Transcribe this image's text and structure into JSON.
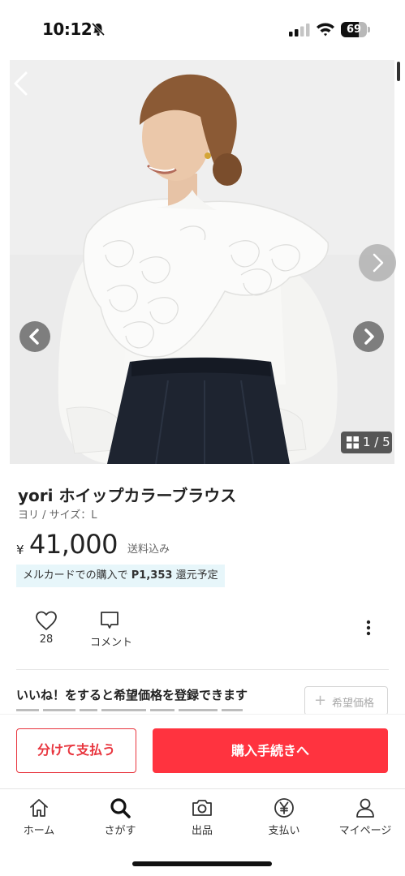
{
  "status": {
    "time": "10:12",
    "battery": "69",
    "battery_level": 0.69
  },
  "gallery": {
    "counter": "1 / 5"
  },
  "item": {
    "title": "yori ホイップカラーブラウス",
    "subtitle": "ヨリ / サイズ：L",
    "currency": "¥",
    "price": "41,000",
    "shipping": "送料込み",
    "point_prefix": "メルカードでの購入で",
    "point_value": "P1,353",
    "point_suffix": "還元予定"
  },
  "actions": {
    "like_count": "28",
    "comment_label": "コメント"
  },
  "wish": {
    "text": "いいね！をすると希望価格を登録できます",
    "button_label": "希望価格"
  },
  "purchase": {
    "split_label": "分けて支払う",
    "buy_label": "購入手続きへ"
  },
  "nav": {
    "items": [
      {
        "label": "ホーム",
        "icon": "home-icon"
      },
      {
        "label": "さがす",
        "icon": "search-icon"
      },
      {
        "label": "出品",
        "icon": "camera-icon"
      },
      {
        "label": "支払い",
        "icon": "yen-icon"
      },
      {
        "label": "マイページ",
        "icon": "person-icon"
      }
    ]
  },
  "colors": {
    "accent": "#ff333f",
    "point_badge_bg": "#e7f6fa"
  }
}
